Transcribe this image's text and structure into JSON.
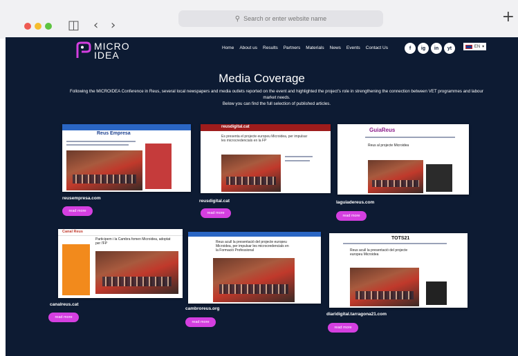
{
  "browser": {
    "url_placeholder": "Search or enter website name"
  },
  "site": {
    "logo_line1": "MICRO",
    "logo_line2": "IDEA",
    "nav": [
      "Home",
      "About us",
      "Results",
      "Partners",
      "Materials",
      "News",
      "Events",
      "Contact Us"
    ],
    "socials": [
      "f",
      "ig",
      "in",
      "yt"
    ],
    "language": "EN",
    "title": "Media Coverage",
    "intro_line1": "Following the MICROIDEA Conference in Reus, several local newspapers and media outlets reported on the event and highlighted the project’s role in strengthening the connection between VET programmes and labour market needs.",
    "intro_line2": "Below you can find the full selection of published articles.",
    "read_more": "read more",
    "articles": [
      {
        "source": "reusempresa.com",
        "masthead": "Reus Empresa",
        "headline": "Reus impulsa el projecte europeu Microidea per connectar la formació professional amb el mercat laboral"
      },
      {
        "source": "reusdigital.cat",
        "masthead": "reusdigital.cat",
        "headline": "Es presenta el projecte europeu Microidea, per impulsar les microcredencials en la FP"
      },
      {
        "source": "laguiadereus.com",
        "masthead": "GuiaReus",
        "headline": "Reus al projecte Microidea"
      },
      {
        "source": "canalreus.cat",
        "masthead": "Canal Reus",
        "headline": "Participem i la Cambra fomen Microidea, adoptat per l'FP"
      },
      {
        "source": "cambroreus.org",
        "masthead": "",
        "headline": "Reus acull la presentació del projecte europeu Microidea, per impulsar les microcredencials en la Formació Professional"
      },
      {
        "source": "diaridigital.tarragona21.com",
        "masthead": "TOTS21",
        "headline": "Reus acull la presentació del projecte europeu Microidea"
      }
    ]
  }
}
